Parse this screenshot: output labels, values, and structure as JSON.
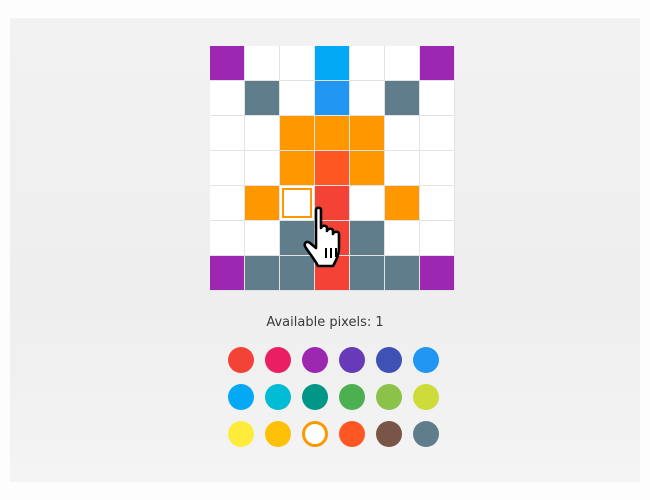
{
  "status": {
    "available_pixels_label": "Available pixels: 1"
  },
  "grid": {
    "rows": 7,
    "cols": 7,
    "selected_cell": [
      4,
      2
    ],
    "colors": [
      [
        "#9c27b0",
        "#ffffff",
        "#ffffff",
        "#03a9f4",
        "#ffffff",
        "#ffffff",
        "#9c27b0"
      ],
      [
        "#ffffff",
        "#607d8b",
        "#ffffff",
        "#2196f3",
        "#ffffff",
        "#607d8b",
        "#ffffff"
      ],
      [
        "#ffffff",
        "#ffffff",
        "#ff9800",
        "#ff9800",
        "#ff9800",
        "#ffffff",
        "#ffffff"
      ],
      [
        "#ffffff",
        "#ffffff",
        "#ff9800",
        "#ff5722",
        "#ff9800",
        "#ffffff",
        "#ffffff"
      ],
      [
        "#ffffff",
        "#ff9800",
        "#ffffff",
        "#f44336",
        "#ffffff",
        "#ff9800",
        "#ffffff"
      ],
      [
        "#ffffff",
        "#ffffff",
        "#607d8b",
        "#f44336",
        "#607d8b",
        "#ffffff",
        "#ffffff"
      ],
      [
        "#9c27b0",
        "#607d8b",
        "#607d8b",
        "#f44336",
        "#607d8b",
        "#607d8b",
        "#9c27b0"
      ]
    ]
  },
  "palette": {
    "selected_index": 14,
    "colors": [
      "#f44336",
      "#e91e63",
      "#9c27b0",
      "#673ab7",
      "#3f51b5",
      "#2196f3",
      "#03a9f4",
      "#00bcd4",
      "#009688",
      "#4caf50",
      "#8bc34a",
      "#cddc39",
      "#ffeb3b",
      "#ffc107",
      "#ff9800",
      "#ff5722",
      "#795548",
      "#607d8b"
    ]
  },
  "cursor": {
    "icon": "hand-pointer-icon"
  }
}
